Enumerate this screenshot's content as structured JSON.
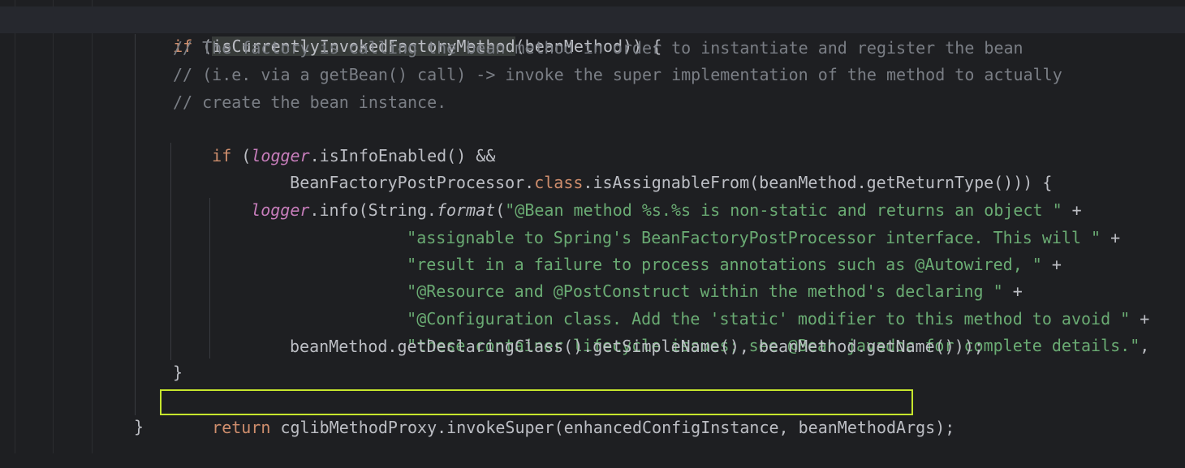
{
  "editor": {
    "theme_colors": {
      "background": "#1e1f22",
      "keyword": "#cf8e6d",
      "string": "#6aab73",
      "comment": "#7a7e85",
      "field": "#c77dbb",
      "text": "#bcbec4",
      "highlight_box": "#c6e52d"
    },
    "lines": [
      {
        "kw": "if",
        "rest_a": " (",
        "fn": "isCurrentlyInvokedFactoryMethod",
        "rest_b": "(beanMethod)) {"
      },
      {
        "comment": "// The factory is calling the bean method in order to instantiate and register the bean"
      },
      {
        "comment": "// (i.e. via a getBean() call) -> invoke the super implementation of the method to actually"
      },
      {
        "comment": "// create the bean instance."
      },
      {
        "kw": "if",
        "rest_a": " (",
        "field": "logger",
        "rest_b": ".isInfoEnabled() &&"
      },
      {
        "a": "BeanFactoryPostProcessor.",
        "kw": "class",
        "b": ".isAssignableFrom(beanMethod.getReturnType())) {"
      },
      {
        "field": "logger",
        "a": ".info(String.",
        "italic": "format",
        "b": "(",
        "str": "\"@Bean method %s.%s is non-static and returns an object \"",
        "c": " +"
      },
      {
        "str": "\"assignable to Spring's BeanFactoryPostProcessor interface. This will \"",
        "c": " +"
      },
      {
        "str": "\"result in a failure to process annotations such as @Autowired, \"",
        "c": " +"
      },
      {
        "str": "\"@Resource and @PostConstruct within the method's declaring \"",
        "c": " +"
      },
      {
        "str": "\"@Configuration class. Add the 'static' modifier to this method to avoid \"",
        "c": " +"
      },
      {
        "str": "\"these container lifecycle issues; see @Bean javadoc for complete details.\"",
        "c": ","
      },
      {
        "a": "beanMethod.getDeclaringClass().getSimpleName(), beanMethod.getName()));"
      },
      {
        "a": "}"
      },
      {
        "kw": "return",
        "a": " cglibMethodProxy.invokeSuper(enhancedConfigInstance, beanMethodArgs);"
      },
      {
        "a": "}"
      }
    ]
  }
}
